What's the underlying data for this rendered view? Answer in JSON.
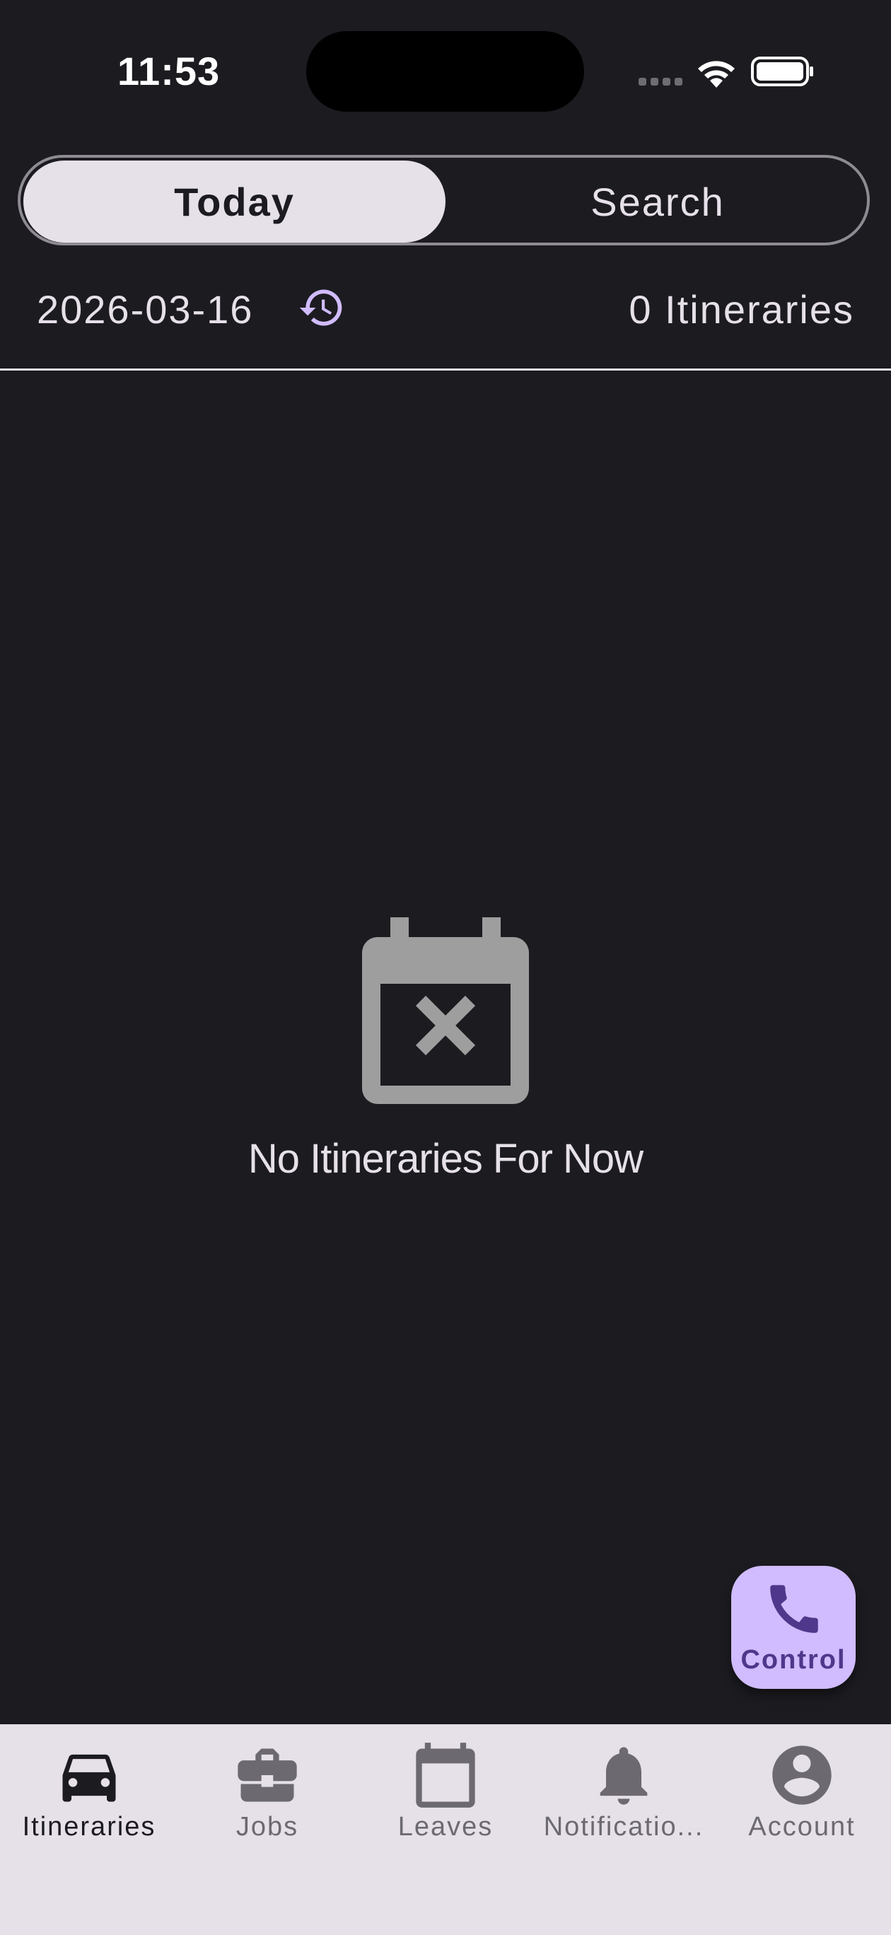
{
  "status_bar": {
    "time": "11:53"
  },
  "segments": {
    "today_label": "Today",
    "search_label": "Search",
    "selected": "Today"
  },
  "date_row": {
    "date": "2026-03-16",
    "count_label": "0 Itineraries"
  },
  "empty_state": {
    "icon": "calendar-x-icon",
    "message": "No Itineraries For Now"
  },
  "fab": {
    "icon": "phone-icon",
    "label": "Control"
  },
  "bottom_nav": {
    "active": "Itineraries",
    "items": [
      {
        "label": "Itineraries",
        "icon": "car-icon"
      },
      {
        "label": "Jobs",
        "icon": "briefcase-icon"
      },
      {
        "label": "Leaves",
        "icon": "calendar-icon"
      },
      {
        "label": "Notificatio...",
        "icon": "bell-icon"
      },
      {
        "label": "Account",
        "icon": "account-circle-icon"
      }
    ]
  },
  "colors": {
    "background": "#1c1b20",
    "accent": "#d0bcfe",
    "on_accent": "#4f378b",
    "nav_background": "#e6e0e9",
    "text": "#e6e0e9",
    "muted_icon": "#9e9e9e"
  }
}
